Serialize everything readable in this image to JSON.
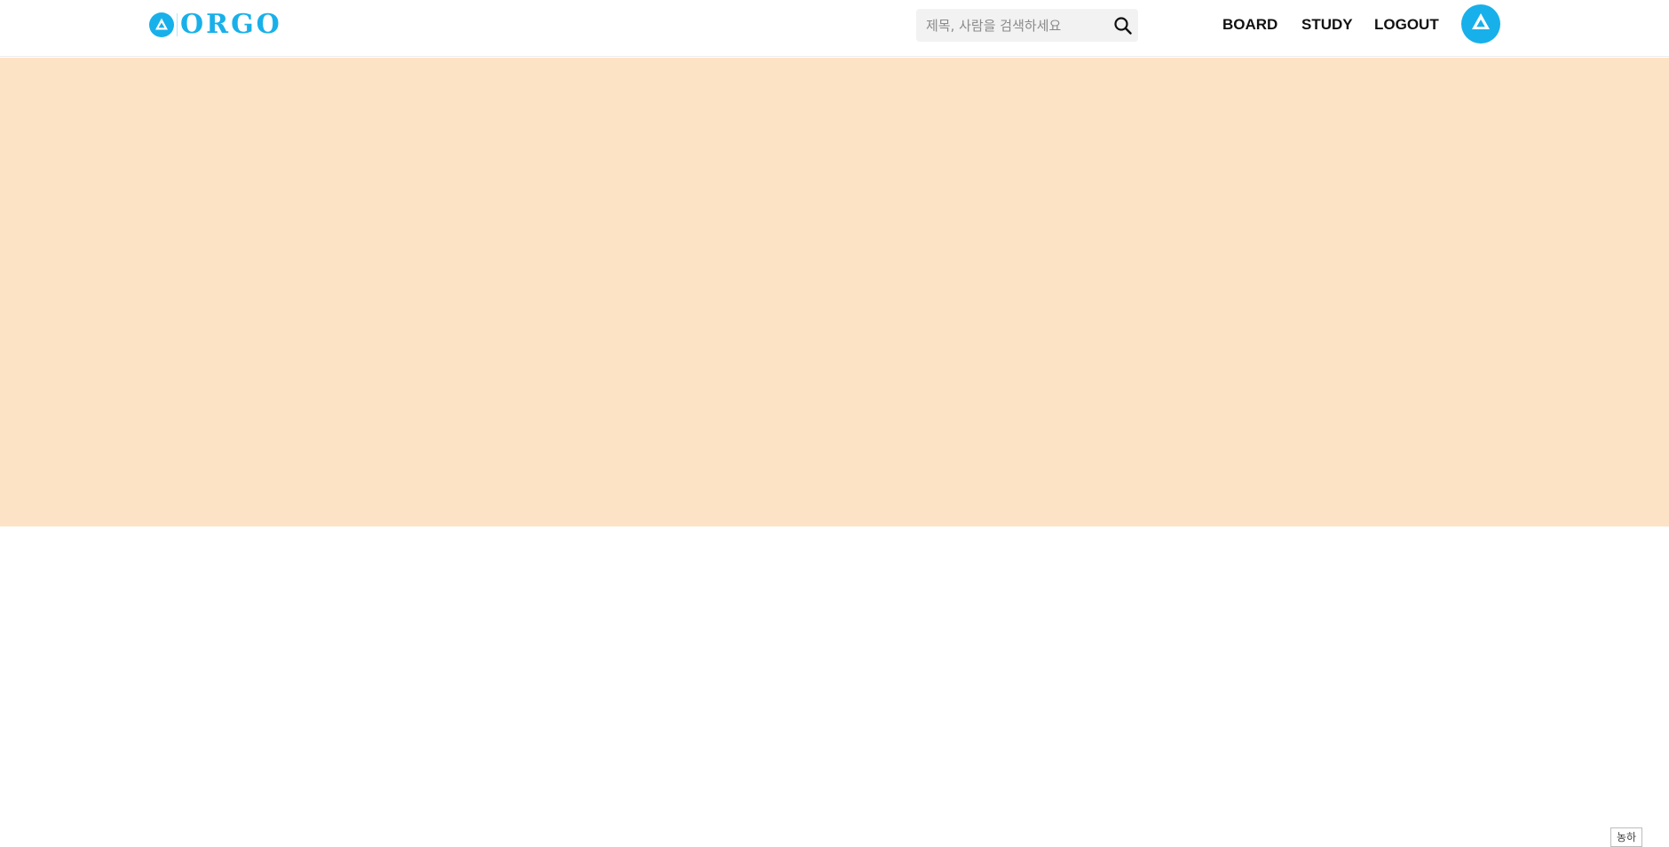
{
  "header": {
    "logo_text": "ORGO",
    "search": {
      "placeholder": "제목, 사람을 검색하세요",
      "value": ""
    },
    "nav": {
      "board": "BOARD",
      "study": "STUDY",
      "logout": "LOGOUT"
    }
  },
  "banner": {
    "color": "#fde3c5"
  },
  "corner_button": {
    "label": "농하"
  },
  "colors": {
    "brand": "#18b0ea",
    "search_bg": "#f2f2f2",
    "nav_text": "#111111"
  },
  "icons": {
    "logo": "orgo-logo-triangle-icon",
    "search": "search-icon",
    "avatar": "user-avatar-icon"
  }
}
